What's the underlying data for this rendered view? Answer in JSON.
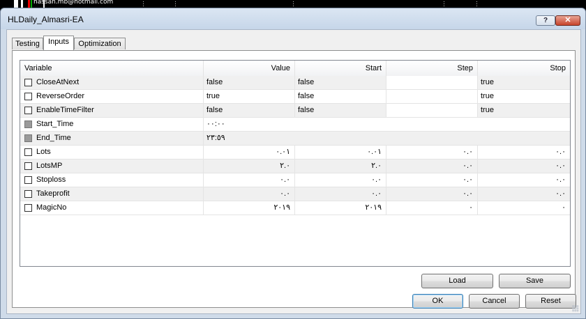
{
  "background": {
    "email": "hassan.mb@hotmail.com"
  },
  "window": {
    "title": "HLDaily_Almasri-EA",
    "help_label": "?",
    "close_label": "✕"
  },
  "tabs": [
    {
      "label": "Testing",
      "active": false
    },
    {
      "label": "Inputs",
      "active": true
    },
    {
      "label": "Optimization",
      "active": false
    }
  ],
  "grid": {
    "headers": {
      "variable": "Variable",
      "value": "Value",
      "start": "Start",
      "step": "Step",
      "stop": "Stop"
    },
    "rows": [
      {
        "name": "CloseAtNext",
        "checked": false,
        "value": "false",
        "start": "false",
        "step": "",
        "stop": "true"
      },
      {
        "name": "ReverseOrder",
        "checked": false,
        "value": "true",
        "start": "false",
        "step": "",
        "stop": "true"
      },
      {
        "name": "EnableTimeFilter",
        "checked": false,
        "value": "false",
        "start": "false",
        "step": "",
        "stop": "true"
      },
      {
        "name": "Start_Time",
        "checked": false,
        "disabled": true,
        "value": "٠٠:٠٠"
      },
      {
        "name": "End_Time",
        "checked": false,
        "disabled": true,
        "value": "٢٣:٥٩"
      },
      {
        "name": "Lots",
        "checked": false,
        "value": "٠.٠١",
        "start": "٠.٠١",
        "step": "٠.٠",
        "stop": "٠.٠"
      },
      {
        "name": "LotsMP",
        "checked": false,
        "value": "٢.٠",
        "start": "٢.٠",
        "step": "٠.٠",
        "stop": "٠.٠"
      },
      {
        "name": "Stoploss",
        "checked": false,
        "value": "٠.٠",
        "start": "٠.٠",
        "step": "٠.٠",
        "stop": "٠.٠"
      },
      {
        "name": "Takeprofit",
        "checked": false,
        "value": "٠.٠",
        "start": "٠.٠",
        "step": "٠.٠",
        "stop": "٠.٠"
      },
      {
        "name": "MagicNo",
        "checked": false,
        "value": "٢٠١٩",
        "start": "٢٠١٩",
        "step": "٠",
        "stop": "٠"
      }
    ]
  },
  "buttons": {
    "load": "Load",
    "save": "Save",
    "ok": "OK",
    "cancel": "Cancel",
    "reset": "Reset"
  }
}
